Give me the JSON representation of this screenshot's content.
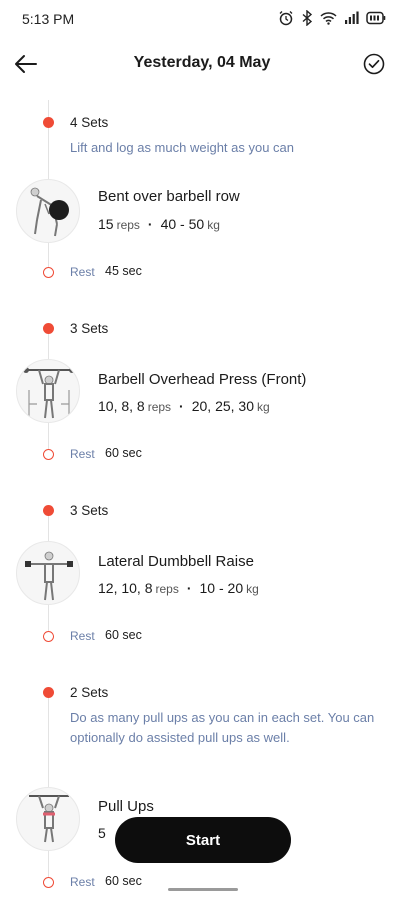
{
  "status_bar": {
    "time": "5:13 PM",
    "icons": [
      "alarm-icon",
      "bluetooth-icon",
      "wifi-icon",
      "signal-icon",
      "battery-icon"
    ]
  },
  "header": {
    "title": "Yesterday, 04 May",
    "back_icon": "back-arrow-icon",
    "done_icon": "check-circle-icon"
  },
  "exercises": [
    {
      "sets_label": "4 Sets",
      "note": "Lift and log as much weight as you can",
      "name": "Bent over barbell row",
      "reps": "15",
      "reps_unit": "reps",
      "weight": "40 - 50",
      "weight_unit": "kg",
      "rest_label": "Rest",
      "rest_value": "45 sec"
    },
    {
      "sets_label": "3 Sets",
      "note": "",
      "name": "Barbell Overhead Press (Front)",
      "reps": "10, 8, 8",
      "reps_unit": "reps",
      "weight": "20, 25, 30",
      "weight_unit": "kg",
      "rest_label": "Rest",
      "rest_value": "60 sec"
    },
    {
      "sets_label": "3 Sets",
      "note": "",
      "name": "Lateral Dumbbell Raise",
      "reps": "12, 10, 8",
      "reps_unit": "reps",
      "weight": "10 - 20",
      "weight_unit": "kg",
      "rest_label": "Rest",
      "rest_value": "60 sec"
    },
    {
      "sets_label": "2 Sets",
      "note": "Do as many pull ups as you can in each set. You can optionally do assisted pull ups as well.",
      "name": "Pull Ups",
      "reps": "5",
      "reps_unit": "",
      "weight": "",
      "weight_unit": "",
      "rest_label": "Rest",
      "rest_value": "60 sec"
    }
  ],
  "start_button": "Start",
  "colors": {
    "accent": "#ef4b36",
    "note_text": "#6b7fa8",
    "button_bg": "#0d0d0d"
  }
}
